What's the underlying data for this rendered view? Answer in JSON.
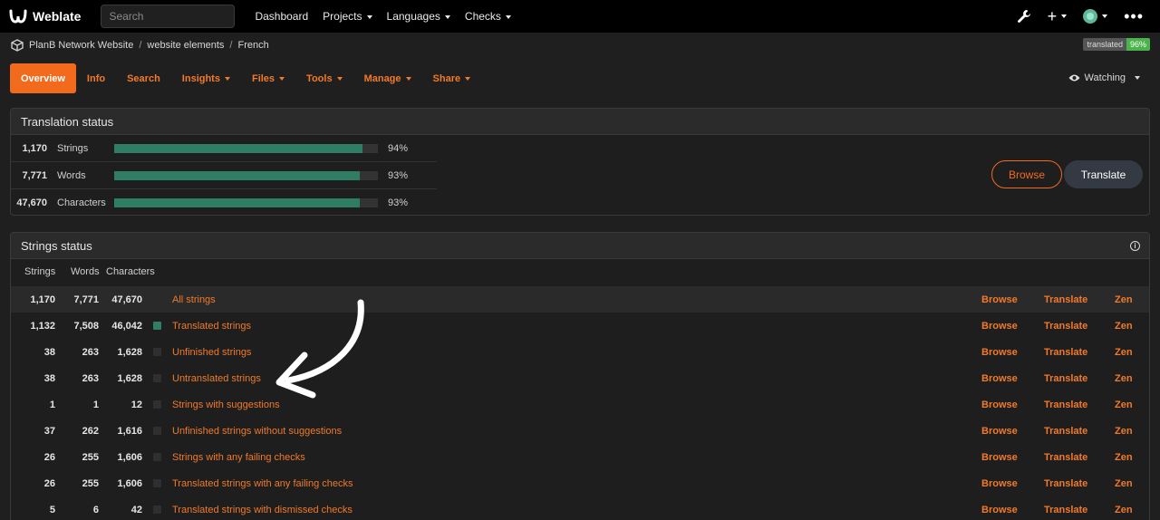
{
  "topbar": {
    "brand": "Weblate",
    "search_placeholder": "Search",
    "nav": [
      {
        "label": "Dashboard",
        "caret": false
      },
      {
        "label": "Projects",
        "caret": true
      },
      {
        "label": "Languages",
        "caret": true
      },
      {
        "label": "Checks",
        "caret": true
      }
    ],
    "icons": [
      "wrench-icon",
      "plus-icon",
      "avatar",
      "more-icon"
    ]
  },
  "breadcrumb": [
    "PlanB Network Website",
    "website elements",
    "French"
  ],
  "badge": {
    "label": "translated",
    "value": "96%"
  },
  "tabs": [
    "Overview",
    "Info",
    "Search",
    "Insights",
    "Files",
    "Tools",
    "Manage",
    "Share"
  ],
  "watching": "Watching",
  "translation_status": {
    "title": "Translation status",
    "rows": [
      {
        "count": "1,170",
        "label": "Strings",
        "percent": "94%",
        "fill": 0.94
      },
      {
        "count": "7,771",
        "label": "Words",
        "percent": "93%",
        "fill": 0.93
      },
      {
        "count": "47,670",
        "label": "Characters",
        "percent": "93%",
        "fill": 0.93
      }
    ],
    "browse": "Browse",
    "translate": "Translate"
  },
  "strings_status": {
    "title": "Strings status",
    "columns": [
      "Strings",
      "Words",
      "Characters"
    ],
    "action_labels": {
      "browse": "Browse",
      "translate": "Translate",
      "zen": "Zen"
    },
    "rows": [
      {
        "strings": "1,170",
        "words": "7,771",
        "chars": "47,670",
        "label": "All strings",
        "swatch": "none"
      },
      {
        "strings": "1,132",
        "words": "7,508",
        "chars": "46,042",
        "label": "Translated strings",
        "swatch": "green"
      },
      {
        "strings": "38",
        "words": "263",
        "chars": "1,628",
        "label": "Unfinished strings",
        "swatch": "grey"
      },
      {
        "strings": "38",
        "words": "263",
        "chars": "1,628",
        "label": "Untranslated strings",
        "swatch": "grey"
      },
      {
        "strings": "1",
        "words": "1",
        "chars": "12",
        "label": "Strings with suggestions",
        "swatch": "grey"
      },
      {
        "strings": "37",
        "words": "262",
        "chars": "1,616",
        "label": "Unfinished strings without suggestions",
        "swatch": "grey"
      },
      {
        "strings": "26",
        "words": "255",
        "chars": "1,606",
        "label": "Strings with any failing checks",
        "swatch": "grey"
      },
      {
        "strings": "26",
        "words": "255",
        "chars": "1,606",
        "label": "Translated strings with any failing checks",
        "swatch": "grey"
      },
      {
        "strings": "5",
        "words": "6",
        "chars": "42",
        "label": "Translated strings with dismissed checks",
        "swatch": "grey"
      }
    ]
  },
  "colors": {
    "accent": "#f26a1b",
    "bar": "#2e7d64",
    "badge_green": "#4bb34b"
  }
}
